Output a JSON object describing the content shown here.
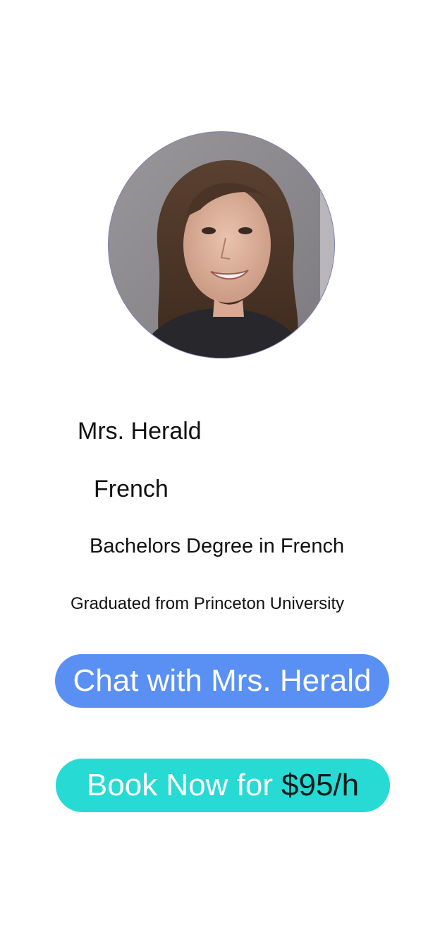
{
  "profile": {
    "avatar_alt": "Tutor photo",
    "name": "Mrs. Herald",
    "subject": "French",
    "degree": "Bachelors Degree in French",
    "education": "Graduated from Princeton University"
  },
  "actions": {
    "chat_label": "Chat with Mrs. Herald",
    "book_label": "Book Now for",
    "book_price": "$95/h"
  },
  "colors": {
    "chat_button": "#5a90f3",
    "book_button": "#27dad4",
    "background": "#ffffff"
  }
}
